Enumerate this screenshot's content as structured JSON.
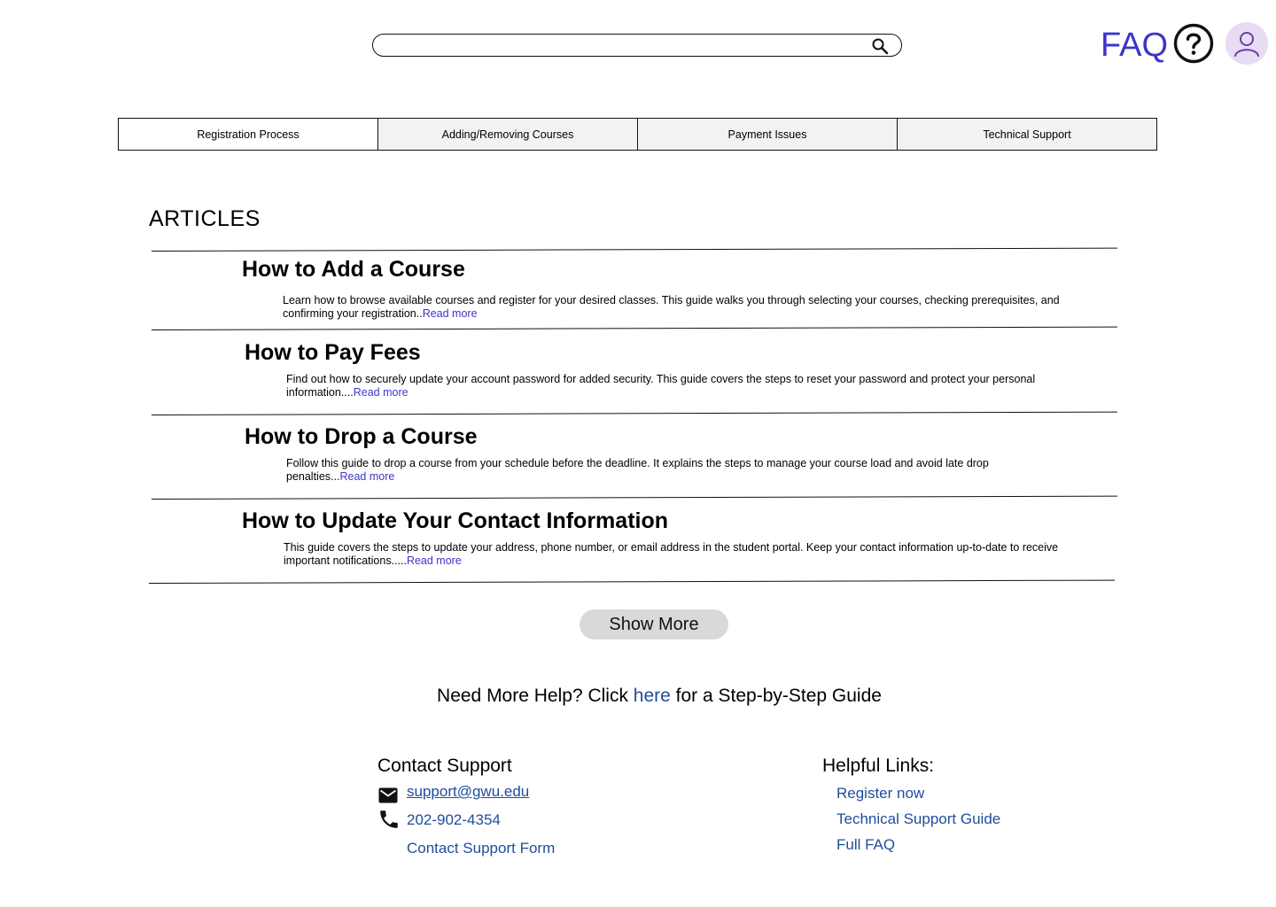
{
  "header": {
    "search": {
      "placeholder": "",
      "value": ""
    },
    "title": "FAQ"
  },
  "tabs": [
    {
      "label": "Registration Process",
      "active": true
    },
    {
      "label": "Adding/Removing Courses",
      "active": false
    },
    {
      "label": "Payment Issues",
      "active": false
    },
    {
      "label": "Technical Support",
      "active": false
    }
  ],
  "articles": {
    "heading": "ARTICLES",
    "read_more_label": "Read more",
    "items": [
      {
        "title": "How to Add a Course",
        "summary": "Learn how to browse available courses and register for your desired classes. This guide walks you through selecting your courses, checking prerequisites, and confirming your registration..",
        "read_more": "Read more"
      },
      {
        "title": "How to Pay Fees",
        "summary": "Find out how to securely update your account password for added security. This guide covers the steps to reset your password and protect your personal information....",
        "read_more": "Read more"
      },
      {
        "title": "How to Drop a Course",
        "summary": "Follow this guide to drop a course from your schedule before the deadline. It explains the steps to manage your course load and avoid late drop penalties...",
        "read_more": "Read more"
      },
      {
        "title": "How to Update Your Contact Information",
        "summary": "This guide covers the steps to update your address, phone number, or email address in the student portal. Keep your contact information up-to-date to receive important notifications.....",
        "read_more": "Read more"
      }
    ]
  },
  "show_more_label": "Show More",
  "help_prompt": {
    "before": "Need More Help? Click ",
    "link": "here",
    "after": " for a Step-by-Step Guide"
  },
  "footer": {
    "contact": {
      "heading": "Contact Support",
      "email": "support@gwu.edu",
      "phone": "202-902-4354",
      "form": "Contact Support Form"
    },
    "links": {
      "heading": "Helpful Links:",
      "items": [
        "Register now",
        "Technical Support Guide",
        "Full FAQ"
      ]
    }
  },
  "colors": {
    "accent": "#3d35c8",
    "link": "#1f4d9c",
    "avatar_bg": "#e7dcf4",
    "tab_inactive_bg": "#f3f2f3",
    "button_bg": "#d9d9d9"
  }
}
